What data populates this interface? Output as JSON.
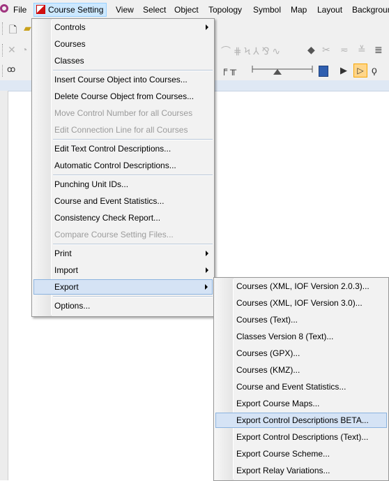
{
  "menubar": {
    "items": [
      "File",
      "Course Setting",
      "View",
      "Select",
      "Object",
      "Topology",
      "Symbol",
      "Map",
      "Layout",
      "Background"
    ]
  },
  "course_setting_menu": {
    "controls": "Controls",
    "courses": "Courses",
    "classes": "Classes",
    "insert_course_object": "Insert Course Object into Courses...",
    "delete_course_object": "Delete Course Object from Courses...",
    "move_control_number": "Move Control Number for all Courses",
    "edit_connection_line": "Edit Connection Line for all Courses",
    "edit_text_control_descriptions": "Edit Text Control Descriptions...",
    "automatic_control_descriptions": "Automatic Control Descriptions...",
    "punching_unit_ids": "Punching Unit IDs...",
    "course_event_statistics": "Course and Event Statistics...",
    "consistency_check_report": "Consistency Check Report...",
    "compare_course_setting_files": "Compare Course Setting Files...",
    "print": "Print",
    "import": "Import",
    "export": "Export",
    "options": "Options..."
  },
  "export_submenu": {
    "courses_xml_203": "Courses (XML, IOF Version 2.0.3)...",
    "courses_xml_30": "Courses (XML, IOF Version 3.0)...",
    "courses_text": "Courses (Text)...",
    "classes_v8_text": "Classes Version 8 (Text)...",
    "courses_gpx": "Courses (GPX)...",
    "courses_kmz": "Courses (KMZ)...",
    "course_event_statistics": "Course and Event Statistics...",
    "export_course_maps": "Export Course Maps...",
    "export_control_descriptions_beta": "Export Control Descriptions BETA...",
    "export_control_descriptions_text": "Export Control Descriptions (Text)...",
    "export_course_scheme": "Export Course Scheme...",
    "export_relay_variations": "Export Relay Variations..."
  },
  "colors": {
    "menu_bg": "#f2f2f2",
    "highlight": "#d5e3f5",
    "highlight_border": "#8bb3df",
    "active_top_menu": "#cce8ff",
    "disabled_text": "#9b9b9b",
    "accent_orange": "#f7a600"
  }
}
